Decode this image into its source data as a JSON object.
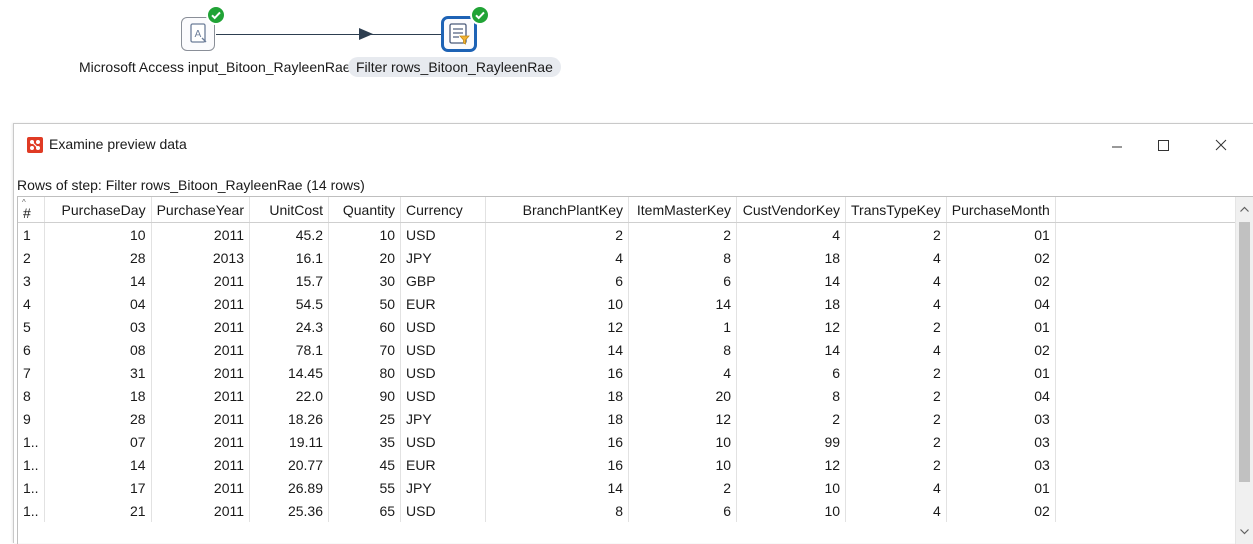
{
  "canvas": {
    "steps": [
      {
        "label": "Microsoft Access input_Bitoon_RayleenRae",
        "icon": "access-input-icon",
        "status": "success"
      },
      {
        "label": "Filter rows_Bitoon_RayleenRae",
        "icon": "filter-rows-icon",
        "status": "success",
        "selected": true
      }
    ]
  },
  "dialog": {
    "title": "Examine preview data",
    "subtitle": "Rows of step: Filter rows_Bitoon_RayleenRae (14 rows)",
    "window_controls": [
      "minimize-icon",
      "maximize-icon",
      "close-icon"
    ],
    "accent_color": "#1e63b5"
  },
  "grid": {
    "columns": [
      "#",
      "PurchaseDay",
      "PurchaseYear",
      "UnitCost",
      "Quantity",
      "Currency",
      "BranchPlantKey",
      "ItemMasterKey",
      "CustVendorKey",
      "TransTypeKey",
      "PurchaseMonth"
    ],
    "rows": [
      [
        "1",
        "10",
        "2011",
        "45.2",
        "10",
        "USD",
        "2",
        "2",
        "4",
        "2",
        "01"
      ],
      [
        "2",
        "28",
        "2013",
        "16.1",
        "20",
        "JPY",
        "4",
        "8",
        "18",
        "4",
        "02"
      ],
      [
        "3",
        "14",
        "2011",
        "15.7",
        "30",
        "GBP",
        "6",
        "6",
        "14",
        "4",
        "02"
      ],
      [
        "4",
        "04",
        "2011",
        "54.5",
        "50",
        "EUR",
        "10",
        "14",
        "18",
        "4",
        "04"
      ],
      [
        "5",
        "03",
        "2011",
        "24.3",
        "60",
        "USD",
        "12",
        "1",
        "12",
        "2",
        "01"
      ],
      [
        "6",
        "08",
        "2011",
        "78.1",
        "70",
        "USD",
        "14",
        "8",
        "14",
        "4",
        "02"
      ],
      [
        "7",
        "31",
        "2011",
        "14.45",
        "80",
        "USD",
        "16",
        "4",
        "6",
        "2",
        "01"
      ],
      [
        "8",
        "18",
        "2011",
        "22.0",
        "90",
        "USD",
        "18",
        "20",
        "8",
        "2",
        "04"
      ],
      [
        "9",
        "28",
        "2011",
        "18.26",
        "25",
        "JPY",
        "18",
        "12",
        "2",
        "2",
        "03"
      ],
      [
        "1..",
        "07",
        "2011",
        "19.11",
        "35",
        "USD",
        "16",
        "10",
        "99",
        "2",
        "03"
      ],
      [
        "1..",
        "14",
        "2011",
        "20.77",
        "45",
        "EUR",
        "16",
        "10",
        "12",
        "2",
        "03"
      ],
      [
        "1..",
        "17",
        "2011",
        "26.89",
        "55",
        "JPY",
        "14",
        "2",
        "10",
        "4",
        "01"
      ],
      [
        "1..",
        "21",
        "2011",
        "25.36",
        "65",
        "USD",
        "8",
        "6",
        "10",
        "4",
        "02"
      ]
    ]
  }
}
